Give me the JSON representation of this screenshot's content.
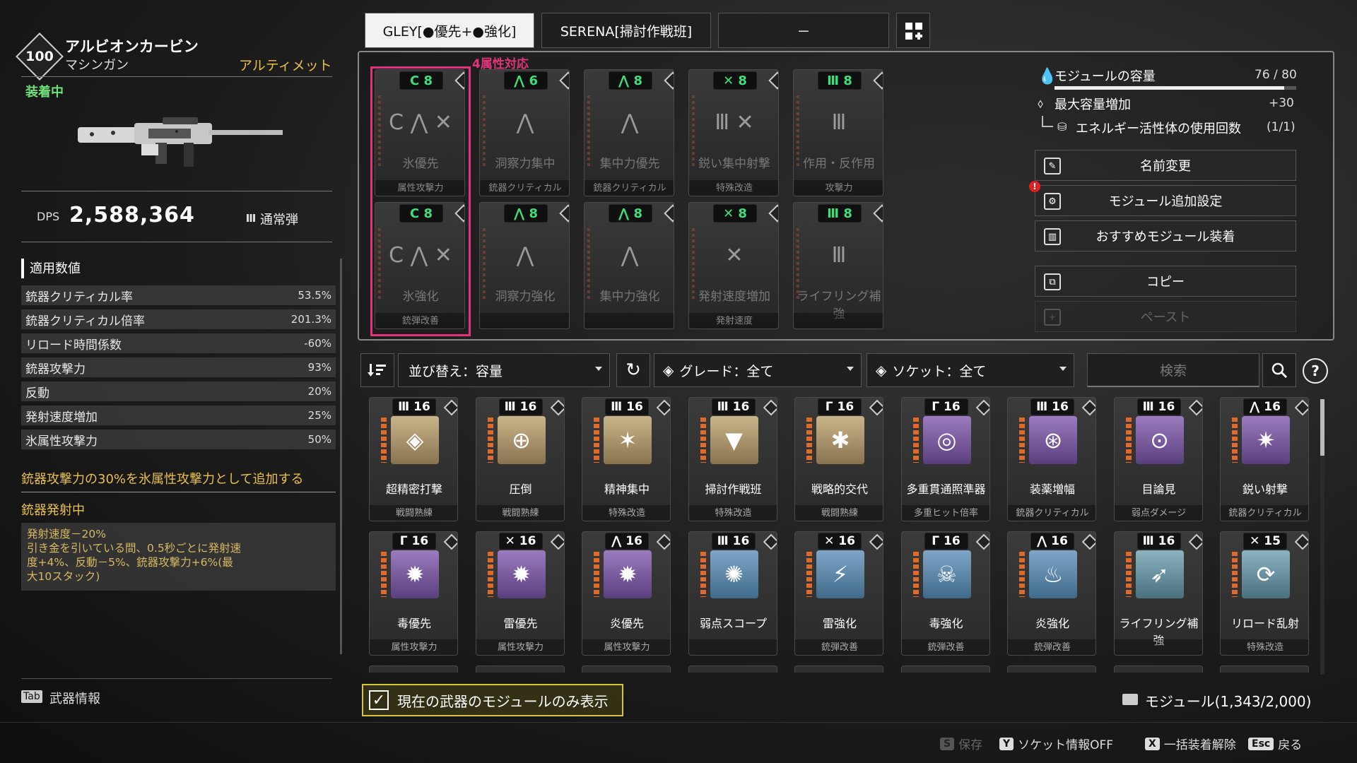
{
  "weapon": {
    "level": "100",
    "name": "アルビオンカービン",
    "type": "マシンガン",
    "rarity": "アルティメット",
    "equipped": "装着中",
    "dps_label": "DPS",
    "dps_value": "2,588,364",
    "ammo": "通常弾"
  },
  "stats": {
    "heading": "適用数値",
    "rows": [
      {
        "label": "銃器クリティカル率",
        "value": "53.5%"
      },
      {
        "label": "銃器クリティカル倍率",
        "value": "201.3%"
      },
      {
        "label": "リロード時間係数",
        "value": "-60%"
      },
      {
        "label": "銃器攻撃力",
        "value": "93%"
      },
      {
        "label": "反動",
        "value": "20%"
      },
      {
        "label": "発射速度増加",
        "value": "25%"
      },
      {
        "label": "氷属性攻撃力",
        "value": "50%"
      }
    ],
    "bonus": "銃器攻撃力の30%を氷属性攻撃力として追加する",
    "skill_title": "銃器発射中",
    "skill_desc_1": "発射速度－20%",
    "skill_desc_2": "引き金を引いている間、0.5秒ごとに発射速",
    "skill_desc_3": "度+4%、反動－5%、銃器攻撃力+6%(最",
    "skill_desc_4": "大10スタック)"
  },
  "left_footer": {
    "key": "Tab",
    "label": "武器情報"
  },
  "tabs": [
    {
      "label": "GLEY[●優先+●強化]"
    },
    {
      "label": "SERENA[掃討作戦班]"
    },
    {
      "label": "－"
    }
  ],
  "highlight_label": "4属性対応",
  "equipped_slots": [
    {
      "socket": "C 8",
      "name": "氷優先",
      "category": "属性攻撃力",
      "glyph": "C ⋀ ✕"
    },
    {
      "socket": "⋀ 6",
      "name": "洞察力集中",
      "category": "銃器クリティカル",
      "glyph": "⋀"
    },
    {
      "socket": "⋀ 8",
      "name": "集中力優先",
      "category": "銃器クリティカル",
      "glyph": "⋀"
    },
    {
      "socket": "✕ 8",
      "name": "鋭い集中射撃",
      "category": "特殊改造",
      "glyph": "Ⅲ ✕"
    },
    {
      "socket": "Ⅲ 8",
      "name": "作用・反作用",
      "category": "攻撃力",
      "glyph": "Ⅲ"
    },
    {
      "socket": "C 8",
      "name": "氷強化",
      "category": "銃弾改善",
      "glyph": "C ⋀ ✕"
    },
    {
      "socket": "⋀ 8",
      "name": "洞察力強化",
      "category": "",
      "glyph": "⋀"
    },
    {
      "socket": "⋀ 8",
      "name": "集中力強化",
      "category": "",
      "glyph": "⋀"
    },
    {
      "socket": "✕ 8",
      "name": "発射速度増加",
      "category": "発射速度",
      "glyph": "✕"
    },
    {
      "socket": "Ⅲ 8",
      "name": "ライフリング補強",
      "category": "",
      "glyph": "Ⅲ"
    }
  ],
  "capacity": {
    "label": "モジュールの容量",
    "value": "76 / 80",
    "fill_ratio": 0.95,
    "increase_label": "最大容量増加",
    "increase_value": "+30",
    "energy_label": "エネルギー活性体の使用回数",
    "energy_value": "(1/1)"
  },
  "right_buttons": [
    {
      "label": "名前変更",
      "icon": "pencil-icon"
    },
    {
      "label": "モジュール追加設定",
      "icon": "gear-icon"
    },
    {
      "label": "おすすめモジュール装着",
      "icon": "chart-icon"
    },
    {
      "label": "コピー",
      "icon": "copy-icon"
    },
    {
      "label": "ペースト",
      "icon": "paste-icon"
    }
  ],
  "alert_mark": "!",
  "filters": {
    "sort": "並び替え：容量",
    "grade": "グレード：全て",
    "socket": "ソケット：全て",
    "search_placeholder": "検索",
    "help": "?"
  },
  "module_cards": [
    {
      "socket": "Ⅲ 16",
      "name": "超精密打撃",
      "category": "戦闘熟練",
      "color": "gold",
      "glyph": "◈"
    },
    {
      "socket": "Ⅲ 16",
      "name": "圧倒",
      "category": "戦闘熟練",
      "color": "gold",
      "glyph": "⊕"
    },
    {
      "socket": "Ⅲ 16",
      "name": "精神集中",
      "category": "特殊改造",
      "color": "gold",
      "glyph": "✶"
    },
    {
      "socket": "Ⅲ 16",
      "name": "掃討作戦班",
      "category": "特殊改造",
      "color": "gold",
      "glyph": "▼"
    },
    {
      "socket": "Γ 16",
      "name": "戦略的交代",
      "category": "戦闘熟練",
      "color": "gold",
      "glyph": "✱"
    },
    {
      "socket": "Γ 16",
      "name": "多重貫通照準器",
      "category": "多重ヒット倍率",
      "color": "purple",
      "glyph": "◎"
    },
    {
      "socket": "Ⅲ 16",
      "name": "装薬増幅",
      "category": "銃器クリティカル",
      "color": "purple",
      "glyph": "⊛"
    },
    {
      "socket": "Ⅲ 16",
      "name": "目論見",
      "category": "弱点ダメージ",
      "color": "purple",
      "glyph": "⊙"
    },
    {
      "socket": "⋀ 16",
      "name": "鋭い射撃",
      "category": "銃器クリティカル",
      "color": "purple",
      "glyph": "✷"
    },
    {
      "socket": "Γ 16",
      "name": "毒優先",
      "category": "属性攻撃力",
      "color": "purple",
      "glyph": "✹"
    },
    {
      "socket": "✕ 16",
      "name": "雷優先",
      "category": "属性攻撃力",
      "color": "purple",
      "glyph": "✹"
    },
    {
      "socket": "⋀ 16",
      "name": "炎優先",
      "category": "属性攻撃力",
      "color": "purple",
      "glyph": "✹"
    },
    {
      "socket": "Ⅲ 16",
      "name": "弱点スコープ",
      "category": "",
      "color": "blue",
      "glyph": "✺"
    },
    {
      "socket": "✕ 16",
      "name": "雷強化",
      "category": "銃弾改善",
      "color": "blue",
      "glyph": "⚡"
    },
    {
      "socket": "Γ 16",
      "name": "毒強化",
      "category": "銃弾改善",
      "color": "blue",
      "glyph": "☠"
    },
    {
      "socket": "⋀ 16",
      "name": "炎強化",
      "category": "銃弾改善",
      "color": "blue",
      "glyph": "♨"
    },
    {
      "socket": "Ⅲ 16",
      "name": "ライフリング補強",
      "category": "",
      "color": "teal",
      "glyph": "➶"
    },
    {
      "socket": "✕ 15",
      "name": "リロード乱射",
      "category": "特殊改造",
      "color": "teal",
      "glyph": "⟳"
    }
  ],
  "bottom": {
    "only_current": "現在の武器のモジュールのみ表示",
    "checkbox_mark": "✓",
    "module_count": "モジュール(1,343/2,000)"
  },
  "hints": [
    {
      "key": "S",
      "label": "保存",
      "dim": true
    },
    {
      "key": "Y",
      "label": "ソケット情報OFF",
      "dim": false
    },
    {
      "key": "X",
      "label": "一括装着解除",
      "dim": false
    },
    {
      "key": "Esc",
      "label": "戻る",
      "dim": false
    }
  ]
}
